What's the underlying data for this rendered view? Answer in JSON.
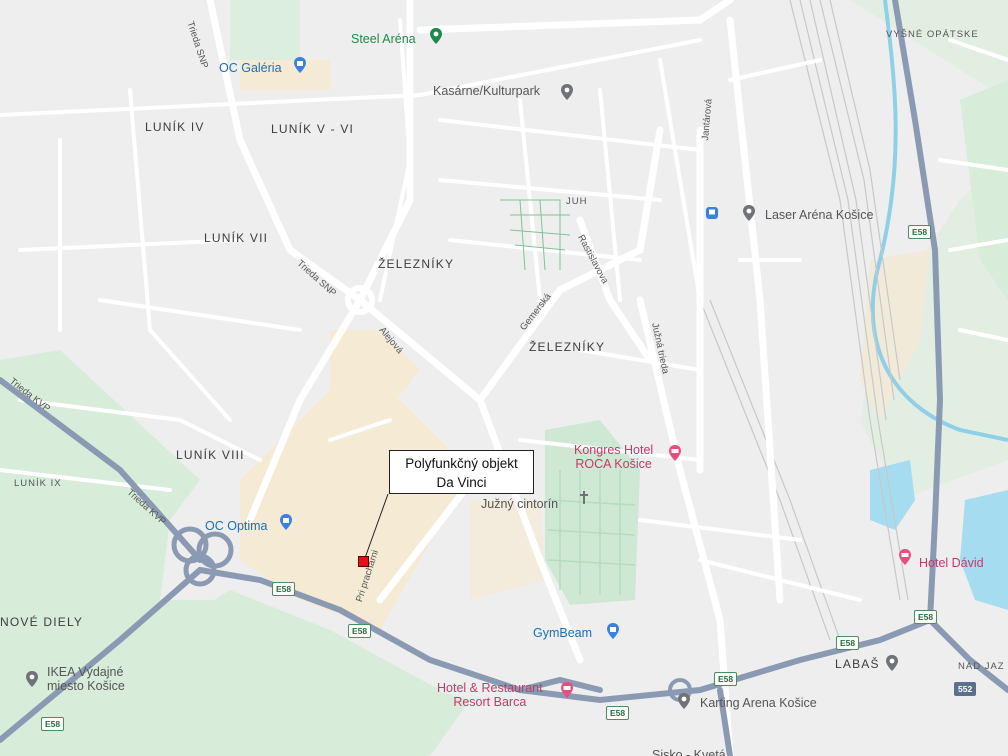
{
  "map": {
    "districts": [
      {
        "id": "lunik-iv",
        "label": "LUNÍK IV"
      },
      {
        "id": "lunik-v-vi",
        "label": "LUNÍK V - VI"
      },
      {
        "id": "lunik-vii",
        "label": "LUNÍK VII"
      },
      {
        "id": "zeleznik-1",
        "label": "ŽELEZNÍKY"
      },
      {
        "id": "zeleznik-2",
        "label": "ŽELEZNÍKY"
      },
      {
        "id": "lunik-viii",
        "label": "LUNÍK VIII"
      },
      {
        "id": "nove-diely",
        "label": "NOVÉ DIELY"
      },
      {
        "id": "lunik-ix",
        "label": "LUNÍK IX"
      },
      {
        "id": "juh",
        "label": "JUH"
      },
      {
        "id": "vysne-opatske",
        "label": "VYŠNÉ OPÁTSKE"
      },
      {
        "id": "labas",
        "label": "LABAŠ"
      },
      {
        "id": "nad-jazerom",
        "label": "NAD JAZ"
      }
    ],
    "streets": [
      {
        "id": "trieda-snp-top",
        "label": "Trieda SNP"
      },
      {
        "id": "trieda-snp-mid",
        "label": "Trieda SNP"
      },
      {
        "id": "aleja",
        "label": "Alejová"
      },
      {
        "id": "gemerska",
        "label": "Gemerská"
      },
      {
        "id": "rastislavova",
        "label": "Rastislavova"
      },
      {
        "id": "juzna-trieda",
        "label": "Južná trieda"
      },
      {
        "id": "jantarova",
        "label": "Jantárová"
      },
      {
        "id": "trieda-kvp-1",
        "label": "Trieda KVP"
      },
      {
        "id": "trieda-kvp-2",
        "label": "Trieda KVP"
      },
      {
        "id": "pri-pracharni",
        "label": "Pri prachárni"
      }
    ],
    "pois": [
      {
        "id": "steel-arena",
        "label": "Steel Aréna",
        "kind": "green"
      },
      {
        "id": "oc-galeria",
        "label": "OC Galéria",
        "kind": "blue"
      },
      {
        "id": "kasarne",
        "label": "Kasárne/Kulturpark",
        "kind": "gray"
      },
      {
        "id": "laser-arena",
        "label": "Laser Aréna Košice",
        "kind": "gray"
      },
      {
        "id": "kongres-hotel",
        "label": "Kongres Hotel",
        "label2": "ROCA Košice",
        "kind": "pink"
      },
      {
        "id": "juzny-cintorin",
        "label": "Južný cintorín",
        "kind": "gray"
      },
      {
        "id": "oc-optima",
        "label": "OC Optima",
        "kind": "blue"
      },
      {
        "id": "hotel-david",
        "label": "Hotel Dávid",
        "kind": "pink"
      },
      {
        "id": "gymbeam",
        "label": "GymBeam",
        "kind": "blue"
      },
      {
        "id": "ikea",
        "label": "IKEA Výdajné",
        "label2": "miesto Košice",
        "kind": "gray"
      },
      {
        "id": "hotel-restaurant",
        "label": "Hotel & Restaurant",
        "label2": "Resort Barca",
        "kind": "pink"
      },
      {
        "id": "karting",
        "label": "Karting Arena Košice",
        "kind": "gray"
      },
      {
        "id": "bottom-cut",
        "label": "Sisko - Kvetá",
        "kind": "gray"
      }
    ],
    "road_shields": [
      "E58",
      "E58",
      "E58",
      "E58",
      "E58",
      "E58",
      "E58",
      "E58",
      "552"
    ],
    "callout": {
      "line1": "Polyfunkčný objekt",
      "line2": "Da Vinci"
    },
    "colors": {
      "background": "#eeeeef",
      "highway": "#8b9ab3",
      "road": "#ffffff",
      "park": "#d7ecd9",
      "commercial": "#f5ead4",
      "water": "#a6dcef",
      "marker": "#e4101a"
    }
  }
}
